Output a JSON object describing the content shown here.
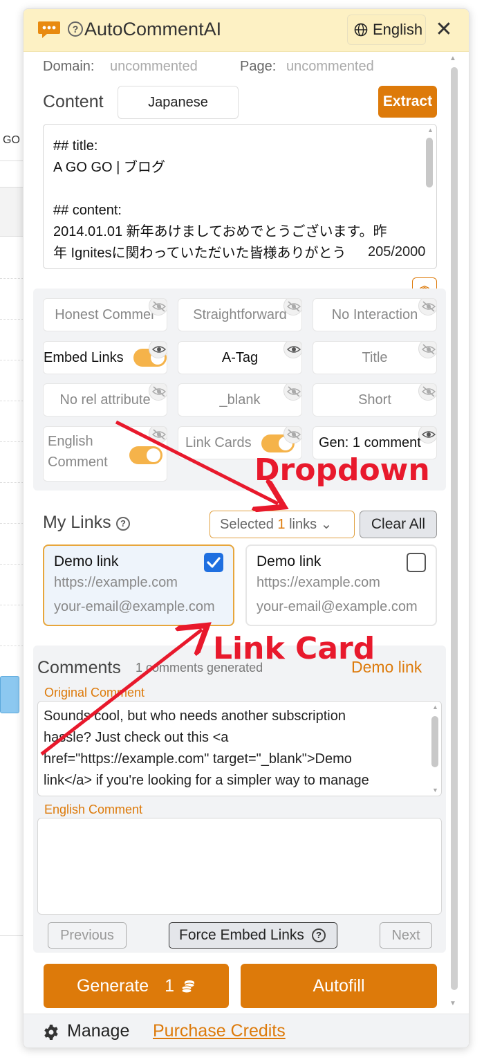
{
  "background_page": {
    "partial_text": "GO"
  },
  "header": {
    "title": "AutoCommentAI",
    "help_glyph": "?",
    "language_button": "English",
    "close_glyph": "✕",
    "logo_icon": "chat-bubble-icon"
  },
  "status": {
    "domain_label": "Domain:",
    "domain_value": "uncommented",
    "page_label": "Page:",
    "page_value": "uncommented"
  },
  "content": {
    "label": "Content",
    "language": "Japanese",
    "extract_label": "Extract",
    "lines": [
      "## title:",
      "A GO GO | ブログ",
      "",
      "## content:",
      "2014.01.01 新年あけましておめでとうございます。昨",
      "年 Ignitesに関わっていただいた皆様ありがとう"
    ],
    "char_count": "205/2000"
  },
  "options": {
    "collapse_glyph": "︽",
    "items": [
      {
        "label": "Honest Commer",
        "active": false,
        "visible": false
      },
      {
        "label": "Straightforward",
        "active": false,
        "visible": false
      },
      {
        "label": "No Interaction",
        "active": false,
        "visible": false
      },
      {
        "label": "Embed Links",
        "active": true,
        "visible": true,
        "toggle": true
      },
      {
        "label": "A-Tag",
        "active": true,
        "visible": true
      },
      {
        "label": "Title",
        "active": false,
        "visible": false
      },
      {
        "label": "No rel attribute",
        "active": false,
        "visible": false
      },
      {
        "label": "_blank",
        "active": false,
        "visible": false
      },
      {
        "label": "Short",
        "active": false,
        "visible": false
      },
      {
        "label_line1": "English",
        "label_line2": "Comment",
        "active": false,
        "visible": false,
        "toggle": true
      },
      {
        "label": "Link Cards",
        "active": false,
        "visible": false,
        "toggle": true
      },
      {
        "label": "Gen: 1 comment",
        "active": true,
        "visible": true
      }
    ]
  },
  "my_links": {
    "label": "My Links",
    "help_glyph": "?",
    "dropdown_prefix": "Selected",
    "dropdown_count": "1",
    "dropdown_suffix": "links",
    "dropdown_caret": "⌄",
    "clear_label": "Clear All",
    "cards": [
      {
        "title": "Demo link",
        "url": "https://example.com",
        "email": "your-email@example.com",
        "checked": true
      },
      {
        "title": "Demo link",
        "url": "https://example.com",
        "email": "your-email@example.com",
        "checked": false
      }
    ]
  },
  "comments": {
    "label": "Comments",
    "count_text": "1 comments generated",
    "link_text": "Demo link",
    "original_label": "Original Comment",
    "original_lines": [
      "Sounds cool, but who needs another subscription",
      "hassle? Just check out this <a",
      "href=\"https://example.com\" target=\"_blank\">Demo",
      "link</a> if you're looking for a simpler way to manage"
    ],
    "english_label": "English Comment",
    "english_text": "",
    "previous_label": "Previous",
    "force_label": "Force Embed Links",
    "force_help": "?",
    "next_label": "Next"
  },
  "actions": {
    "generate_label": "Generate",
    "generate_cost": "1",
    "autofill_label": "Autofill"
  },
  "footer": {
    "manage_label": "Manage",
    "purchase_label": "Purchase Credits"
  },
  "annotations": {
    "dropdown_label": "Dropdown",
    "link_card_label": "Link Card",
    "color": "#e8192c"
  },
  "colors": {
    "accent": "#dd7a0a",
    "header_bg": "#fdf1c4",
    "toggle": "#f5b34a",
    "checkbox": "#1f6fe0"
  }
}
